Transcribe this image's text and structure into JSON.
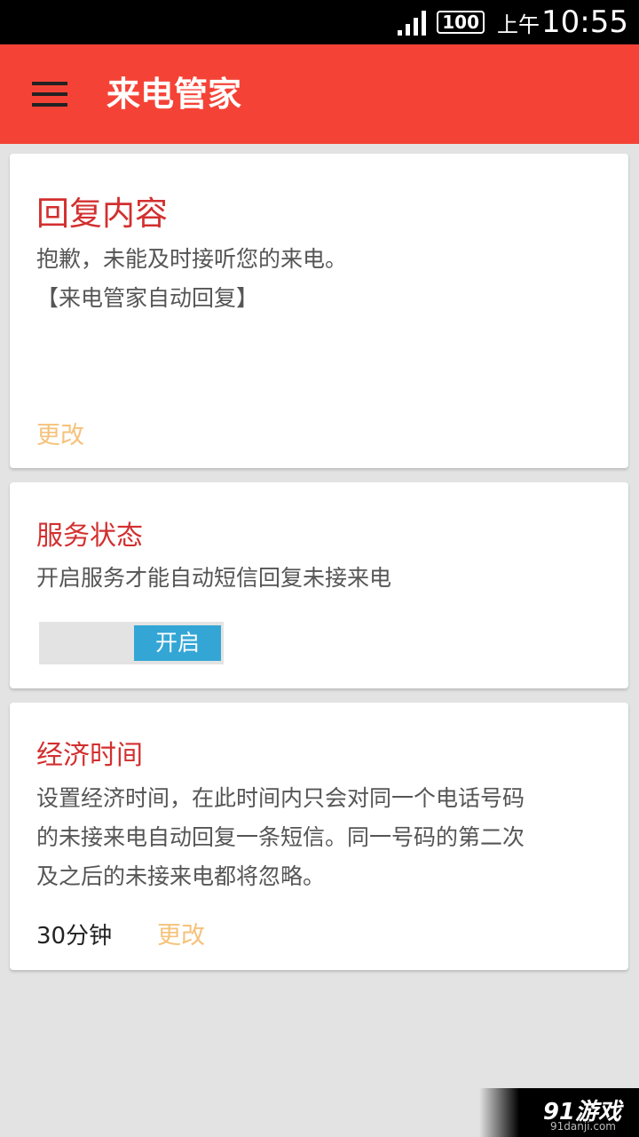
{
  "status_bar": {
    "battery": "100",
    "time_prefix": "上午",
    "time": "10:55"
  },
  "app_bar": {
    "title": "来电管家",
    "menu_icon": "hamburger-menu-icon"
  },
  "reply_card": {
    "title": "回复内容",
    "message_line1": "抱歉，未能及时接听您的来电。",
    "message_line2": "【来电管家自动回复】",
    "change_label": "更改"
  },
  "service_card": {
    "title": "服务状态",
    "description": "开启服务才能自动短信回复未接来电",
    "toggle_label": "开启"
  },
  "economy_card": {
    "title": "经济时间",
    "description_line1": "设置经济时间，在此时间内只会对同一个电话号码",
    "description_line2": "的未接来电自动回复一条短信。同一号码的第二次",
    "description_line3": "及之后的未接来电都将忽略。",
    "value": "30分钟",
    "change_label": "更改"
  },
  "watermark": {
    "main": "91游戏",
    "sub": "91danji.com"
  },
  "colors": {
    "app_bar": "#f44336",
    "card_title": "#d32f2f",
    "link": "#f5c27a",
    "toggle_on": "#33a6d6",
    "background": "#e3e3e3"
  }
}
